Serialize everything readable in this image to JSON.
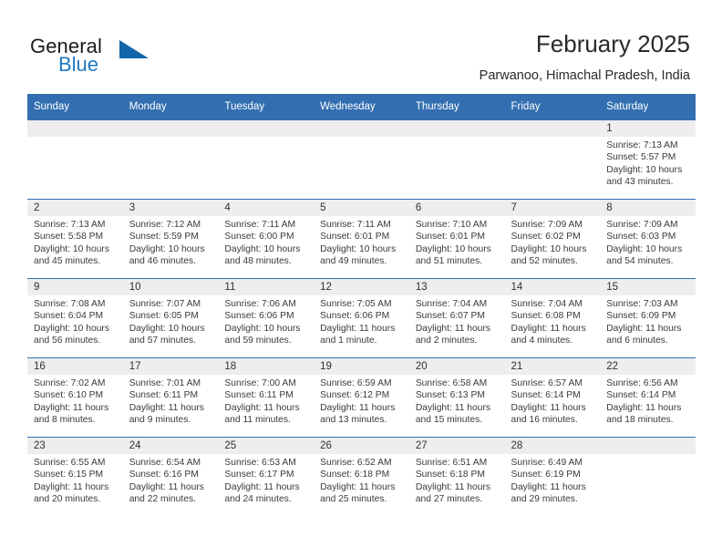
{
  "brand": {
    "name_top": "General",
    "name_bottom": "Blue",
    "accent_color": "#1165a8",
    "text_color": "#1b1b1b"
  },
  "header": {
    "title": "February 2025",
    "subtitle": "Parwanoo, Himachal Pradesh, India"
  },
  "theme": {
    "header_bg": "#336fb0",
    "header_text": "#ffffff",
    "daynum_band_bg": "#eeeeee",
    "row_divider": "#336fb0"
  },
  "weekday_headers": [
    "Sunday",
    "Monday",
    "Tuesday",
    "Wednesday",
    "Thursday",
    "Friday",
    "Saturday"
  ],
  "weeks": [
    [
      {
        "day": "",
        "sunrise": "",
        "sunset": "",
        "daylight": "",
        "empty": true
      },
      {
        "day": "",
        "sunrise": "",
        "sunset": "",
        "daylight": "",
        "empty": true
      },
      {
        "day": "",
        "sunrise": "",
        "sunset": "",
        "daylight": "",
        "empty": true
      },
      {
        "day": "",
        "sunrise": "",
        "sunset": "",
        "daylight": "",
        "empty": true
      },
      {
        "day": "",
        "sunrise": "",
        "sunset": "",
        "daylight": "",
        "empty": true
      },
      {
        "day": "",
        "sunrise": "",
        "sunset": "",
        "daylight": "",
        "empty": true
      },
      {
        "day": "1",
        "sunrise": "Sunrise: 7:13 AM",
        "sunset": "Sunset: 5:57 PM",
        "daylight": "Daylight: 10 hours and 43 minutes.",
        "empty": false
      }
    ],
    [
      {
        "day": "2",
        "sunrise": "Sunrise: 7:13 AM",
        "sunset": "Sunset: 5:58 PM",
        "daylight": "Daylight: 10 hours and 45 minutes.",
        "empty": false
      },
      {
        "day": "3",
        "sunrise": "Sunrise: 7:12 AM",
        "sunset": "Sunset: 5:59 PM",
        "daylight": "Daylight: 10 hours and 46 minutes.",
        "empty": false
      },
      {
        "day": "4",
        "sunrise": "Sunrise: 7:11 AM",
        "sunset": "Sunset: 6:00 PM",
        "daylight": "Daylight: 10 hours and 48 minutes.",
        "empty": false
      },
      {
        "day": "5",
        "sunrise": "Sunrise: 7:11 AM",
        "sunset": "Sunset: 6:01 PM",
        "daylight": "Daylight: 10 hours and 49 minutes.",
        "empty": false
      },
      {
        "day": "6",
        "sunrise": "Sunrise: 7:10 AM",
        "sunset": "Sunset: 6:01 PM",
        "daylight": "Daylight: 10 hours and 51 minutes.",
        "empty": false
      },
      {
        "day": "7",
        "sunrise": "Sunrise: 7:09 AM",
        "sunset": "Sunset: 6:02 PM",
        "daylight": "Daylight: 10 hours and 52 minutes.",
        "empty": false
      },
      {
        "day": "8",
        "sunrise": "Sunrise: 7:09 AM",
        "sunset": "Sunset: 6:03 PM",
        "daylight": "Daylight: 10 hours and 54 minutes.",
        "empty": false
      }
    ],
    [
      {
        "day": "9",
        "sunrise": "Sunrise: 7:08 AM",
        "sunset": "Sunset: 6:04 PM",
        "daylight": "Daylight: 10 hours and 56 minutes.",
        "empty": false
      },
      {
        "day": "10",
        "sunrise": "Sunrise: 7:07 AM",
        "sunset": "Sunset: 6:05 PM",
        "daylight": "Daylight: 10 hours and 57 minutes.",
        "empty": false
      },
      {
        "day": "11",
        "sunrise": "Sunrise: 7:06 AM",
        "sunset": "Sunset: 6:06 PM",
        "daylight": "Daylight: 10 hours and 59 minutes.",
        "empty": false
      },
      {
        "day": "12",
        "sunrise": "Sunrise: 7:05 AM",
        "sunset": "Sunset: 6:06 PM",
        "daylight": "Daylight: 11 hours and 1 minute.",
        "empty": false
      },
      {
        "day": "13",
        "sunrise": "Sunrise: 7:04 AM",
        "sunset": "Sunset: 6:07 PM",
        "daylight": "Daylight: 11 hours and 2 minutes.",
        "empty": false
      },
      {
        "day": "14",
        "sunrise": "Sunrise: 7:04 AM",
        "sunset": "Sunset: 6:08 PM",
        "daylight": "Daylight: 11 hours and 4 minutes.",
        "empty": false
      },
      {
        "day": "15",
        "sunrise": "Sunrise: 7:03 AM",
        "sunset": "Sunset: 6:09 PM",
        "daylight": "Daylight: 11 hours and 6 minutes.",
        "empty": false
      }
    ],
    [
      {
        "day": "16",
        "sunrise": "Sunrise: 7:02 AM",
        "sunset": "Sunset: 6:10 PM",
        "daylight": "Daylight: 11 hours and 8 minutes.",
        "empty": false
      },
      {
        "day": "17",
        "sunrise": "Sunrise: 7:01 AM",
        "sunset": "Sunset: 6:11 PM",
        "daylight": "Daylight: 11 hours and 9 minutes.",
        "empty": false
      },
      {
        "day": "18",
        "sunrise": "Sunrise: 7:00 AM",
        "sunset": "Sunset: 6:11 PM",
        "daylight": "Daylight: 11 hours and 11 minutes.",
        "empty": false
      },
      {
        "day": "19",
        "sunrise": "Sunrise: 6:59 AM",
        "sunset": "Sunset: 6:12 PM",
        "daylight": "Daylight: 11 hours and 13 minutes.",
        "empty": false
      },
      {
        "day": "20",
        "sunrise": "Sunrise: 6:58 AM",
        "sunset": "Sunset: 6:13 PM",
        "daylight": "Daylight: 11 hours and 15 minutes.",
        "empty": false
      },
      {
        "day": "21",
        "sunrise": "Sunrise: 6:57 AM",
        "sunset": "Sunset: 6:14 PM",
        "daylight": "Daylight: 11 hours and 16 minutes.",
        "empty": false
      },
      {
        "day": "22",
        "sunrise": "Sunrise: 6:56 AM",
        "sunset": "Sunset: 6:14 PM",
        "daylight": "Daylight: 11 hours and 18 minutes.",
        "empty": false
      }
    ],
    [
      {
        "day": "23",
        "sunrise": "Sunrise: 6:55 AM",
        "sunset": "Sunset: 6:15 PM",
        "daylight": "Daylight: 11 hours and 20 minutes.",
        "empty": false
      },
      {
        "day": "24",
        "sunrise": "Sunrise: 6:54 AM",
        "sunset": "Sunset: 6:16 PM",
        "daylight": "Daylight: 11 hours and 22 minutes.",
        "empty": false
      },
      {
        "day": "25",
        "sunrise": "Sunrise: 6:53 AM",
        "sunset": "Sunset: 6:17 PM",
        "daylight": "Daylight: 11 hours and 24 minutes.",
        "empty": false
      },
      {
        "day": "26",
        "sunrise": "Sunrise: 6:52 AM",
        "sunset": "Sunset: 6:18 PM",
        "daylight": "Daylight: 11 hours and 25 minutes.",
        "empty": false
      },
      {
        "day": "27",
        "sunrise": "Sunrise: 6:51 AM",
        "sunset": "Sunset: 6:18 PM",
        "daylight": "Daylight: 11 hours and 27 minutes.",
        "empty": false
      },
      {
        "day": "28",
        "sunrise": "Sunrise: 6:49 AM",
        "sunset": "Sunset: 6:19 PM",
        "daylight": "Daylight: 11 hours and 29 minutes.",
        "empty": false
      },
      {
        "day": "",
        "sunrise": "",
        "sunset": "",
        "daylight": "",
        "empty": true
      }
    ]
  ]
}
